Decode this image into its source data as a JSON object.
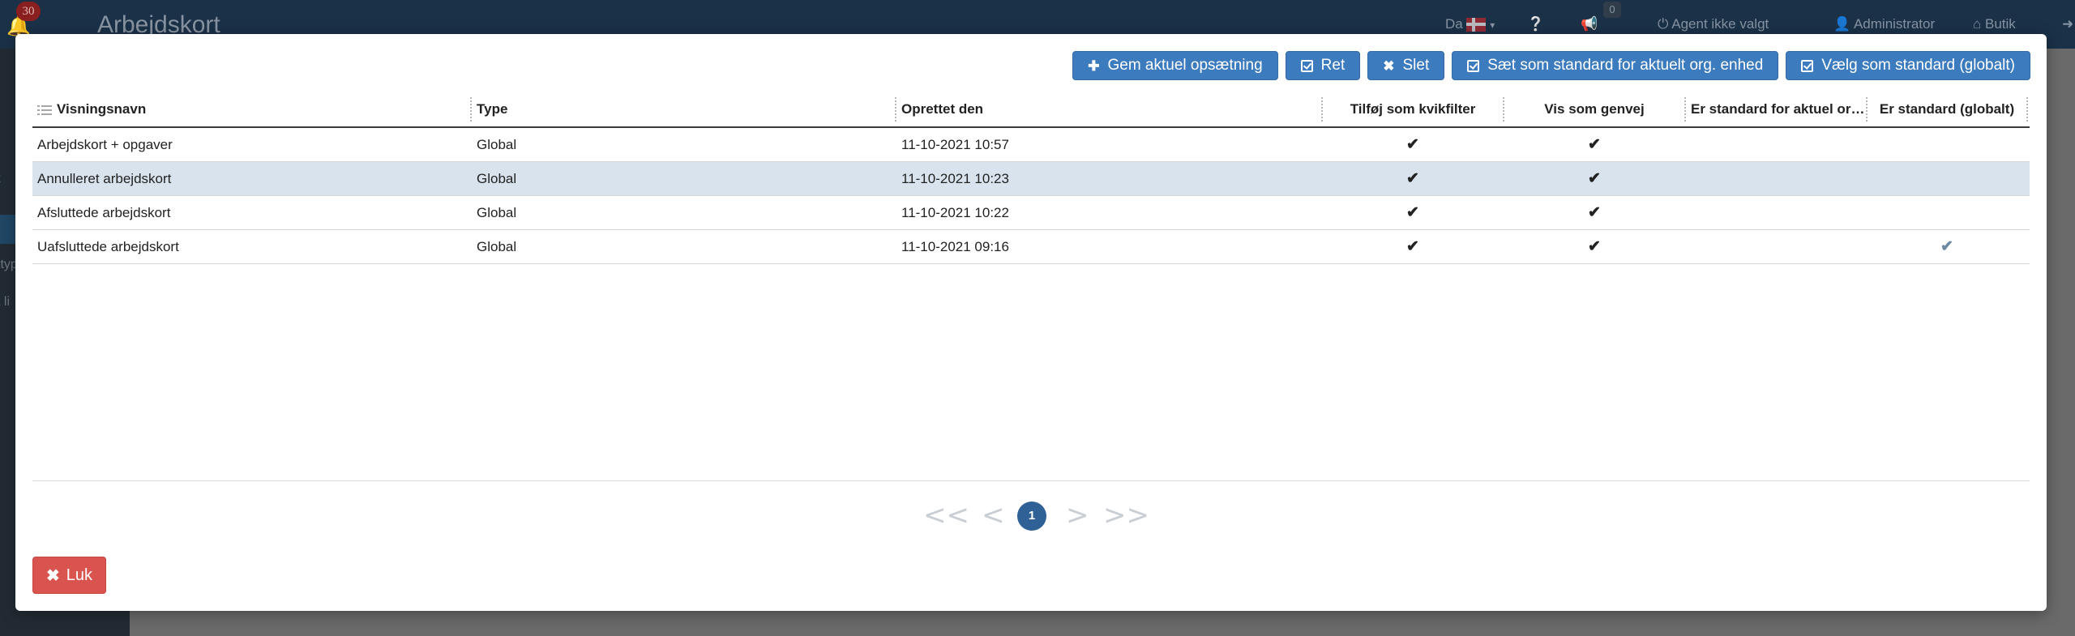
{
  "background": {
    "notifications_count": "30",
    "brand": "Arbejdskort",
    "language": "Da",
    "announcements_count": "0",
    "agent_status": "Agent ikke valgt",
    "user": "Administrator",
    "shop": "Butik",
    "side_fragments": [
      "t",
      "ttyp",
      "t li"
    ]
  },
  "toolbar": {
    "save": "Gem aktuel opsætning",
    "edit": "Ret",
    "delete": "Slet",
    "set_org_default": "Sæt som standard for aktuelt org. enhed",
    "set_global_default": "Vælg som standard (globalt)"
  },
  "table": {
    "columns": {
      "name": "Visningsnavn",
      "type": "Type",
      "created": "Oprettet den",
      "quickfilter": "Tilføj som kvikfilter",
      "shortcut": "Vis som genvej",
      "org_default": "Er standard for aktuel org. enhed",
      "global_default": "Er standard (globalt)"
    },
    "rows": [
      {
        "name": "Arbejdskort + opgaver",
        "type": "Global",
        "created": "11-10-2021 10:57"
      },
      {
        "name": "Annulleret arbejdskort",
        "type": "Global",
        "created": "11-10-2021 10:23"
      },
      {
        "name": "Afsluttede arbejdskort",
        "type": "Global",
        "created": "11-10-2021 10:22"
      },
      {
        "name": "Uafsluttede arbejdskort",
        "type": "Global",
        "created": "11-10-2021 09:16"
      }
    ],
    "check_glyph": "✔"
  },
  "pager": {
    "first": "<<",
    "prev": "<",
    "current": "1",
    "next": ">",
    "last": ">>"
  },
  "close_label": "Luk",
  "colors": {
    "primary": "#3c7bbd",
    "danger": "#d9534f",
    "selected_row": "#d9e3ed",
    "topbar": "#1a3147"
  }
}
